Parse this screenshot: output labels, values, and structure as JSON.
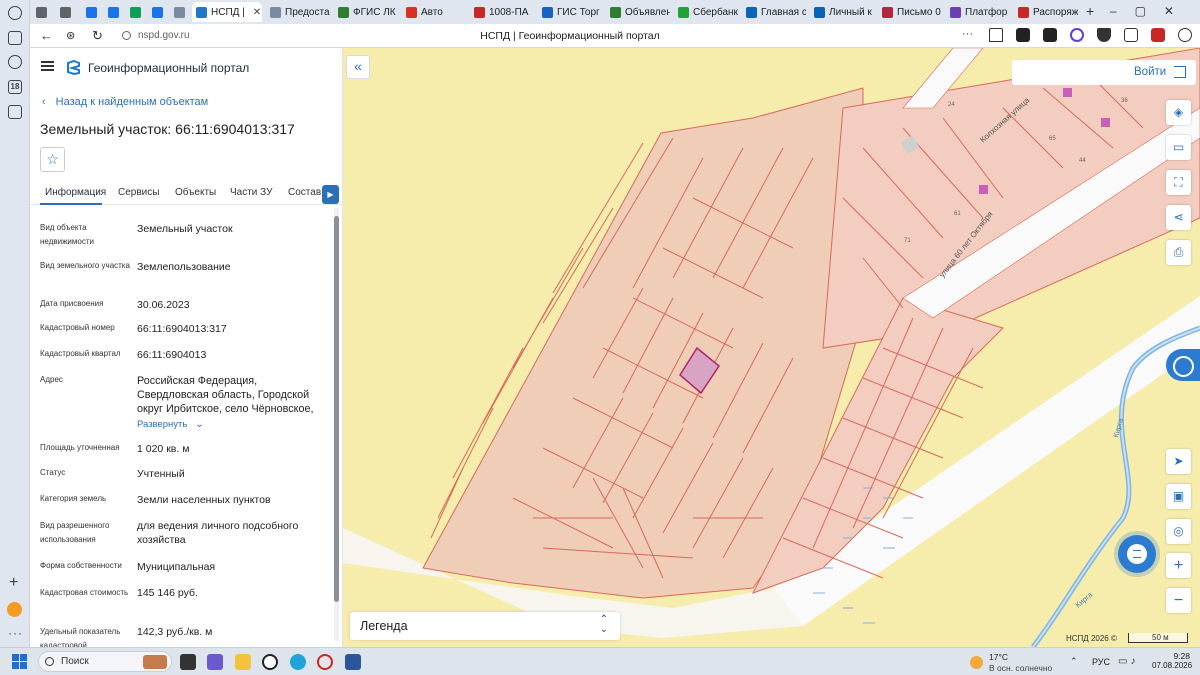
{
  "browser": {
    "tabs": [
      {
        "label": "",
        "color": "#5f6368"
      },
      {
        "label": "",
        "color": "#5f6368"
      },
      {
        "label": "",
        "color": "#1a73e8"
      },
      {
        "label": "",
        "color": "#1a73e8"
      },
      {
        "label": "",
        "color": "#0f9d58"
      },
      {
        "label": "",
        "color": "#1a73e8"
      },
      {
        "label": "",
        "color": "#7a8aa0"
      },
      {
        "label": "НСПД |",
        "color": "#1f78c8",
        "active": true
      },
      {
        "label": "Предоста",
        "color": "#7a8aa0"
      },
      {
        "label": "ФГИС ЛК",
        "color": "#2e7d32"
      },
      {
        "label": "Авто",
        "color": "#d93025"
      },
      {
        "label": "1008-ПА",
        "color": "#c62828"
      },
      {
        "label": "ГИС Торг",
        "color": "#1565c0"
      },
      {
        "label": "Объявлен",
        "color": "#2e7d32"
      },
      {
        "label": "Сбербанк",
        "color": "#21a038"
      },
      {
        "label": "Главная с",
        "color": "#0b63b5"
      },
      {
        "label": "Личный к",
        "color": "#0b63b5"
      },
      {
        "label": "Письмо 0",
        "color": "#b0263c"
      },
      {
        "label": "Платфор",
        "color": "#6a3fb5"
      },
      {
        "label": "Распоряж",
        "color": "#c62828"
      }
    ],
    "url": "nspd.gov.ru",
    "page_title": "НСПД | Геоинформационный портал",
    "rail_badge": "18"
  },
  "panel": {
    "portal_name": "Геоинформационный портал",
    "back_label": "Назад к найденным объектам",
    "object_title": "Земельный участок: 66:11:6904013:317",
    "tabs": [
      "Информация",
      "Сервисы",
      "Объекты",
      "Части ЗУ",
      "Состав"
    ],
    "expand_label": "Развернуть",
    "properties": [
      {
        "key": "Вид объекта недвижимости",
        "value": "Земельный участок"
      },
      {
        "key": "Вид земельного участка",
        "value": "Землепользование"
      },
      {
        "key": "Дата присвоения",
        "value": "30.06.2023"
      },
      {
        "key": "Кадастровый номер",
        "value": "66:11:6904013:317"
      },
      {
        "key": "Кадастровый квартал",
        "value": "66:11:6904013"
      },
      {
        "key": "Адрес",
        "value": "Российская Федерация, Свердловская область, Городской округ Ирбитское, село Чёрновское,"
      },
      {
        "key": "Площадь уточненная",
        "value": "1 020 кв. м"
      },
      {
        "key": "Статус",
        "value": "Учтенный"
      },
      {
        "key": "Категория земель",
        "value": "Земли населенных пунктов"
      },
      {
        "key": "Вид разрешенного использования",
        "value": "для ведения личного подсобного хозяйства"
      },
      {
        "key": "Форма собственности",
        "value": "Муниципальная"
      },
      {
        "key": "Кадастровая стоимость",
        "value": "145 146 руб."
      },
      {
        "key": "Удельный показатель кадастровой",
        "value": "142,3 руб./кв. м"
      }
    ]
  },
  "map": {
    "login_label": "Войти",
    "legend_label": "Легенда",
    "copyright": "НСПД 2026 ©",
    "scale_label": "50 м",
    "street_1": "улица 60 лет Октября",
    "street_2": "Колхозная улица",
    "river_1": "Кирга",
    "river_2": "Кирга",
    "house_numbers": [
      "24",
      "36",
      "65",
      "44",
      "61",
      "71"
    ],
    "colors": {
      "background": "#f6ecac",
      "parcel_fill": "#f3cdbf",
      "parcel_line": "#d9695c",
      "selected": "#b2236e",
      "river": "#7fb4e0",
      "accent": "#2b6fb8"
    }
  },
  "taskbar": {
    "search_placeholder": "Поиск",
    "weather_temp": "17°C",
    "weather_desc": "В осн. солнечно",
    "lang": "РУС",
    "time": "9:28",
    "date": "07.08.2026"
  }
}
